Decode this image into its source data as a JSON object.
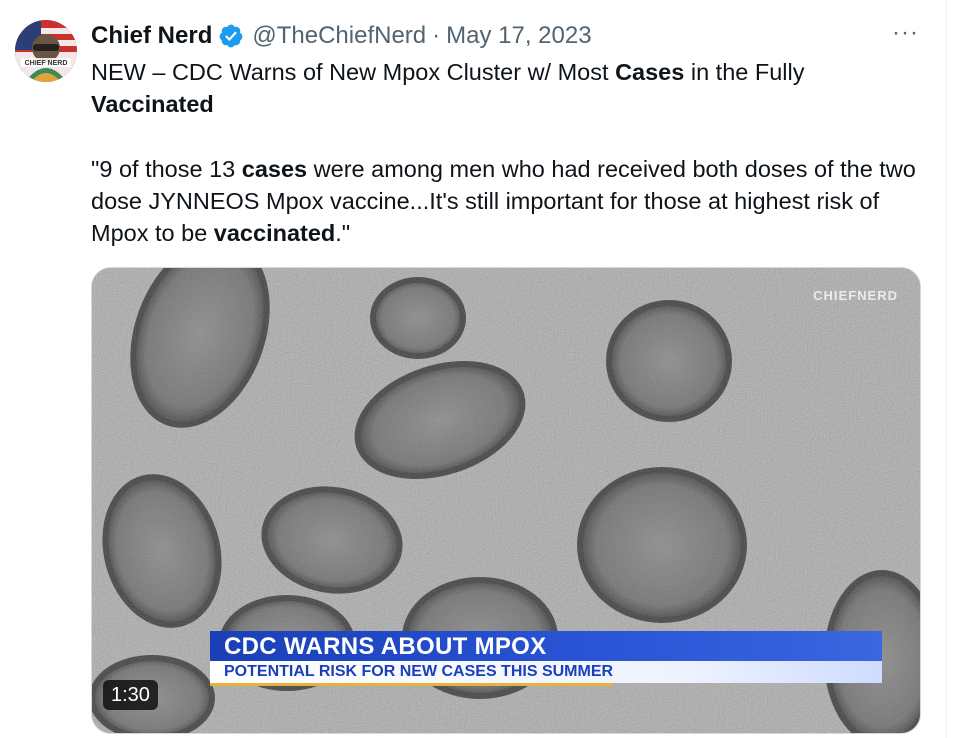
{
  "author": {
    "name": "Chief Nerd",
    "handle": "@TheChiefNerd",
    "date": "May 17, 2023",
    "verified_color": "#1d9bf0",
    "avatar_text": "CHIEF NERD"
  },
  "more_label": "···",
  "separator": "·",
  "tweet": {
    "line1_prefix": "NEW – CDC Warns of New Mpox Cluster w/ Most ",
    "line1_bold": "Cases",
    "line1_suffix": " in the Fully",
    "line2_bold": "Vaccinated",
    "quote_prefix": "\"9 of those 13 ",
    "quote_bold1": "cases",
    "quote_mid": " were among men who had received both doses of the two dose JYNNEOS Mpox vaccine...It's still important for those at highest risk of Mpox to be ",
    "quote_bold2": "vaccinated",
    "quote_suffix": ".\""
  },
  "video": {
    "watermark": "CHIEFNERD",
    "headline": "CDC WARNS ABOUT MPOX",
    "subheadline": "POTENTIAL RISK FOR NEW CASES THIS SUMMER",
    "duration": "1:30",
    "accent_color": "#1a3fb8"
  }
}
